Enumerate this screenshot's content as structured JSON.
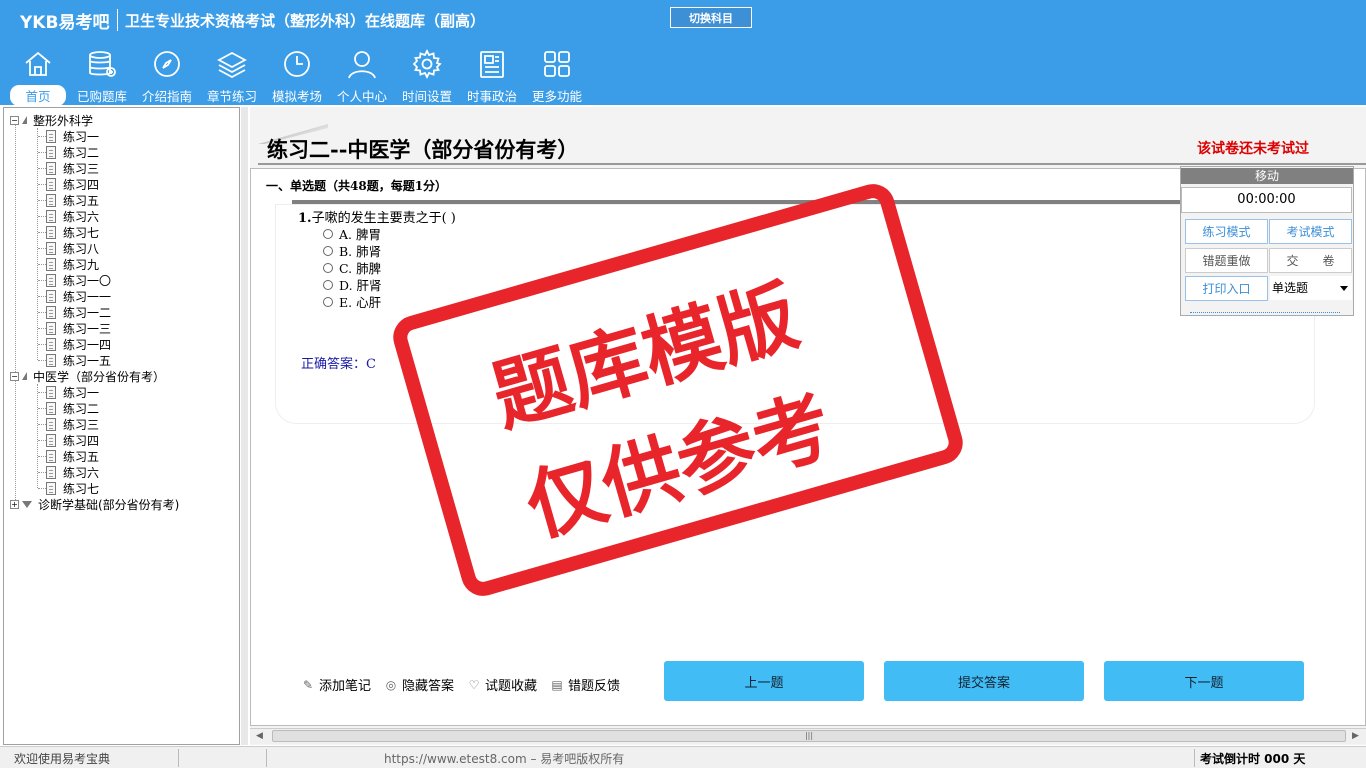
{
  "header": {
    "brand": "YKB易考吧",
    "title": "卫生专业技术资格考试（整形外科）在线题库（副高）",
    "switch_subject": "切换科目",
    "nav": [
      {
        "label": "首页",
        "icon": "home-icon",
        "active": true
      },
      {
        "label": "已购题库",
        "icon": "database-icon"
      },
      {
        "label": "介绍指南",
        "icon": "compass-icon"
      },
      {
        "label": "章节练习",
        "icon": "layers-icon"
      },
      {
        "label": "模拟考场",
        "icon": "clock-icon"
      },
      {
        "label": "个人中心",
        "icon": "user-icon"
      },
      {
        "label": "时间设置",
        "icon": "gear-icon"
      },
      {
        "label": "时事政治",
        "icon": "news-icon"
      },
      {
        "label": "更多功能",
        "icon": "grid-icon"
      }
    ]
  },
  "tree": {
    "groups": [
      {
        "label": "整形外科学",
        "expanded": true,
        "items": [
          "练习一",
          "练习二",
          "练习三",
          "练习四",
          "练习五",
          "练习六",
          "练习七",
          "练习八",
          "练习九",
          "练习一〇",
          "练习一一",
          "练习一二",
          "练习一三",
          "练习一四",
          "练习一五"
        ]
      },
      {
        "label": "中医学（部分省份有考）",
        "expanded": true,
        "items": [
          "练习一",
          "练习二",
          "练习三",
          "练习四",
          "练习五",
          "练习六",
          "练习七"
        ]
      },
      {
        "label": "诊断学基础(部分省份有考)",
        "expanded": false,
        "items": []
      }
    ]
  },
  "exam": {
    "title": "练习二--中医学（部分省份有考）",
    "status": "该试卷还未考试过",
    "section": "一、单选题（共48题，每题1分）",
    "question": {
      "number": "1.",
      "text": "子嗽的发生主要责之于( )",
      "options": [
        "A. 脾胃",
        "B. 肺肾",
        "C. 肺脾",
        "D. 肝肾",
        "E. 心肝"
      ],
      "answer": "正确答案：C"
    },
    "watermark": [
      "题库模版",
      "仅供参考"
    ]
  },
  "side_panel": {
    "move": "移动",
    "timer": "00:00:00",
    "practice_mode": "练习模式",
    "exam_mode": "考试模式",
    "redo_wrong": "错题重做",
    "submit_paper": "交　　卷",
    "print_entry": "打印入口",
    "question_type": "单选题"
  },
  "tools": {
    "add_note": "添加笔记",
    "hide_answer": "隐藏答案",
    "favorite": "试题收藏",
    "feedback": "错题反馈"
  },
  "buttons": {
    "prev": "上一题",
    "submit": "提交答案",
    "next": "下一题"
  },
  "statusbar": {
    "welcome": "欢迎使用易考宝典",
    "copyright": "https://www.etest8.com – 易考吧版权所有",
    "countdown": "考试倒计时 000 天"
  },
  "colors": {
    "header": "#3b9ce8",
    "button": "#41bcf4",
    "stamp": "#e8252b"
  }
}
